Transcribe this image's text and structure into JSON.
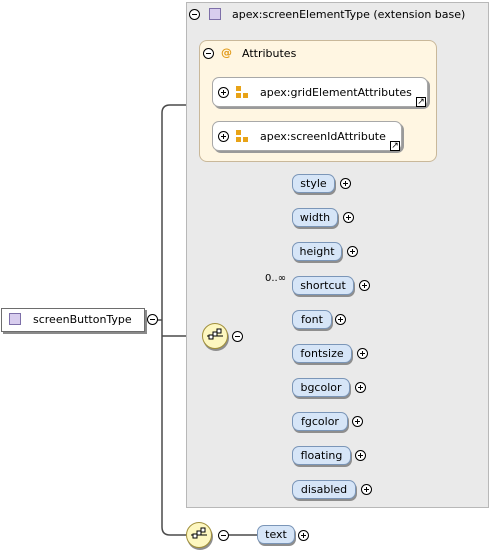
{
  "root": {
    "name": "screenButtonType"
  },
  "extension": {
    "title": "apex:screenElementType (extension base)"
  },
  "attributes": {
    "label": "Attributes",
    "items": [
      {
        "name": "apex:gridElementAttributes"
      },
      {
        "name": "apex:screenIdAttribute"
      }
    ]
  },
  "sequence": {
    "occurrence": "0..∞",
    "elements": [
      "style",
      "width",
      "height",
      "shortcut",
      "font",
      "fontsize",
      "bgcolor",
      "fgcolor",
      "floating",
      "disabled"
    ]
  },
  "extension_sequence": {
    "elements": [
      "text"
    ]
  },
  "colors": {
    "type_icon": "#d8cdee",
    "attribute_group_bg": "#fff6e2",
    "element_fill": "#d6e5f7",
    "compositor_fill": "#fdf7c0",
    "attribute_icon": "#e8a317"
  }
}
